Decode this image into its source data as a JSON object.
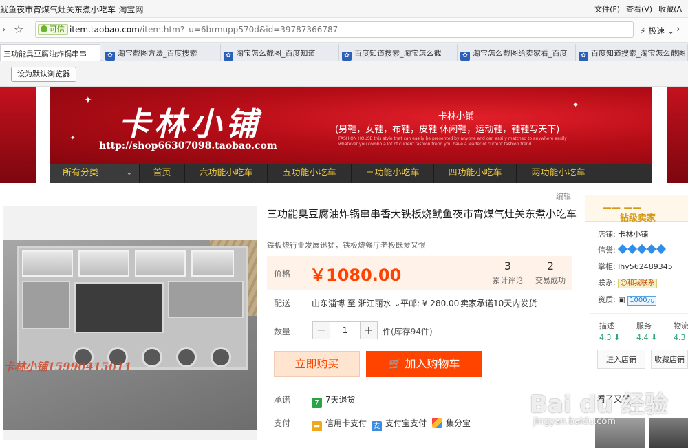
{
  "window": {
    "title": "鱿鱼夜市宵煤气灶关东煮小吃车-淘宝网",
    "menu": [
      "文件(F)",
      "查看(V)",
      "收藏(A"
    ]
  },
  "address_bar": {
    "trust_label": "可信",
    "url_host": "item.taobao.com",
    "url_path": "/item.htm?_u=6brmupp570d&id=39787366787",
    "speed_label": "极速"
  },
  "tabs": [
    {
      "label": "三功能臭豆腐油炸锅串串",
      "active": true
    },
    {
      "label": "淘宝截图方法_百度搜索",
      "active": false
    },
    {
      "label": "淘宝怎么截图_百度知道",
      "active": false
    },
    {
      "label": "百度知道搜索_淘宝怎么截",
      "active": false
    },
    {
      "label": "淘宝怎么截图给卖家看_百度",
      "active": false
    },
    {
      "label": "百度知道搜索_淘宝怎么截图",
      "active": false
    }
  ],
  "default_browser_button": "设为默认浏览器",
  "banner": {
    "brand": "卡林小铺",
    "url": "http://shop66307098.taobao.com",
    "shop_name": "卡林小铺",
    "slogan": "(男鞋，女鞋，布鞋，皮鞋 休闲鞋，运动鞋，鞋鞋写天下)",
    "fashion_text": "FASHION HOUSE this style that can easily be presented by anyone and can easily matched to anywhere easily whatever you combo a lot of current fashion trend you have a leader of current fashion trend"
  },
  "nav": {
    "all_label": "所有分类",
    "items": [
      "首页",
      "六功能小吃车",
      "五功能小吃车",
      "三功能小吃车",
      "四功能小吃车",
      "两功能小吃车"
    ]
  },
  "edit_label": "编辑",
  "product": {
    "title": "三功能臭豆腐油炸锅串串香大铁板烧鱿鱼夜市宵煤气灶关东煮小吃车",
    "subtitle": "铁板烧行业发展迅猛，铁板烧餐厅老板既爱又恨",
    "image_watermark": "卡林小铺15990415611",
    "price_label": "价格",
    "price": "￥1080.00",
    "reviews_count": "3",
    "reviews_label": "累计评论",
    "deals_count": "2",
    "deals_label": "交易成功",
    "shipping_label": "配送",
    "shipping_route": "山东淄博  至  浙江丽水",
    "shipping_fee": "平邮: ¥ 280.00",
    "shipping_promise": "卖家承诺10天内发货",
    "qty_label": "数量",
    "qty_value": "1",
    "stock": "件(库存94件)",
    "buy_label": "立即购买",
    "cart_label": "加入购物车",
    "promise_label": "承诺",
    "promise_value": "7天退货",
    "pay_label": "支付",
    "pay_methods": [
      "信用卡支付",
      "支付宝支付",
      "集分宝"
    ]
  },
  "seller": {
    "header": "钻级卖家",
    "shop_key": "店铺:",
    "shop_value": "卡林小铺",
    "credit_key": "信誉:",
    "owner_key": "掌柜:",
    "owner_value": "lhy562489345",
    "contact_key": "联系:",
    "contact_value": "和我联系",
    "qual_key": "资质:",
    "deposit_value": "1000元",
    "ratings": [
      {
        "label": "描述",
        "value": "4.3"
      },
      {
        "label": "服务",
        "value": "4.4"
      },
      {
        "label": "物流",
        "value": "4.3"
      }
    ],
    "enter_shop": "进入店铺",
    "fav_shop": "收藏店铺",
    "seen_label": "看了又看"
  },
  "baidu_watermark": {
    "logo": "Bai du 经验",
    "url": "jingyan.baidu.com"
  },
  "colors": {
    "price": "#ff4200",
    "cart": "#ff4400",
    "banner": "#c4121e",
    "nav_text": "#e9c23c"
  }
}
